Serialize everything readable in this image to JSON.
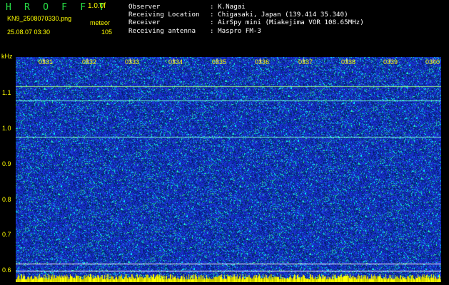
{
  "header": {
    "app_title": "H R O F F T",
    "version": "1.0.0f",
    "filename": "KN9_2508070330.png",
    "mode": "meteor",
    "datetime": "25.08.07 03:30",
    "count": "105"
  },
  "info": {
    "observer_label": "Observer",
    "observer_value": ": K.Nagai",
    "location_label": "Receiving Location",
    "location_value": ": Chigasaki, Japan (139.414 35.340)",
    "receiver_label": "Receiver",
    "receiver_value": ": AirSpy mini (Miakejima VOR 108.65MHz)",
    "antenna_label": "Receiving antenna",
    "antenna_value": ": Maspro FM-3"
  },
  "spectrogram": {
    "y_unit": "kHz",
    "y_ticks": [
      "1.1",
      "1.0",
      "0.9",
      "0.8",
      "0.7",
      "0.6"
    ],
    "x_ticks": [
      "0331",
      "0332",
      "0333",
      "0334",
      "0335",
      "0336",
      "0337",
      "0338",
      "0339",
      "0340"
    ],
    "colors": {
      "background": "#1a24c8",
      "noise_cyan": "#00ffff",
      "noise_green": "#40ff80",
      "label": "#ffff00",
      "title": "#27e046"
    }
  }
}
